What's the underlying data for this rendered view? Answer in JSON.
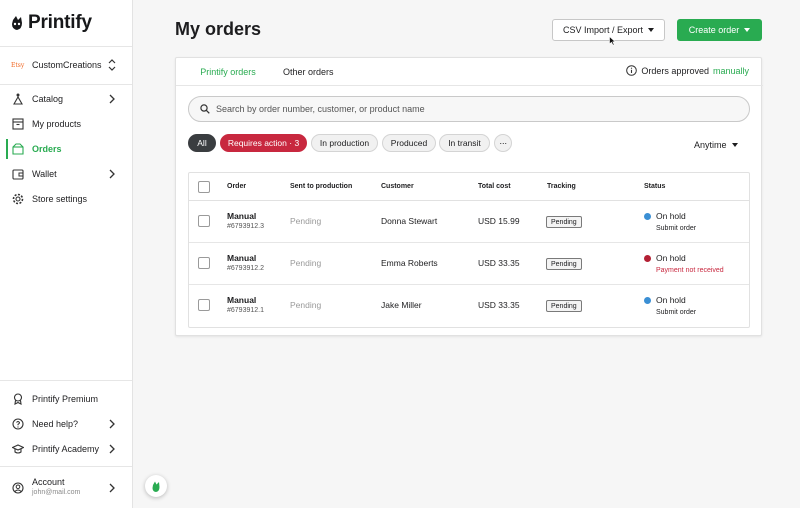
{
  "brand": {
    "name": "Printify",
    "accent": "#29ab51",
    "danger": "#c8283f"
  },
  "store": {
    "badge": "Etsy",
    "name": "CustomCreations"
  },
  "nav": [
    {
      "label": "Catalog",
      "icon": "catalog-icon"
    },
    {
      "label": "My products",
      "icon": "box-icon"
    },
    {
      "label": "Orders",
      "icon": "orders-icon"
    },
    {
      "label": "Wallet",
      "icon": "wallet-icon"
    },
    {
      "label": "Store settings",
      "icon": "gear-icon"
    }
  ],
  "bottom_nav": [
    {
      "label": "Printify Premium",
      "icon": "premium-icon"
    },
    {
      "label": "Need help?",
      "icon": "question-icon"
    },
    {
      "label": "Printify Academy",
      "icon": "academy-icon"
    }
  ],
  "account": {
    "label": "Account",
    "email": "john@mail.com"
  },
  "page": {
    "title": "My orders"
  },
  "header_buttons": {
    "csv": "CSV Import / Export",
    "create": "Create order"
  },
  "tabs": [
    "Printify orders",
    "Other orders"
  ],
  "approval": {
    "text": "Orders approved",
    "link": "manually"
  },
  "search": {
    "placeholder": "Search by order number, customer, or product name",
    "value": ""
  },
  "filters": [
    "All",
    "Requires action · 3",
    "In production",
    "Produced",
    "In transit",
    "···"
  ],
  "date_filter": "Anytime",
  "table": {
    "headers": [
      "Order",
      "Sent to production",
      "Customer",
      "Total cost",
      "Tracking",
      "Status"
    ],
    "rows": [
      {
        "order": "Manual",
        "order_id": "#6793912.3",
        "sent": "Pending",
        "customer": "Donna Stewart",
        "total": "USD 15.99",
        "tracking": "Pending",
        "status": "On hold",
        "status_sub": "Submit order",
        "dot_color": "#3b8fd4",
        "sub_color": "#1d1d1f"
      },
      {
        "order": "Manual",
        "order_id": "#6793912.2",
        "sent": "Pending",
        "customer": "Emma Roberts",
        "total": "USD 33.35",
        "tracking": "Pending",
        "status": "On hold",
        "status_sub": "Payment not received",
        "dot_color": "#b32034",
        "sub_color": "#c8283f"
      },
      {
        "order": "Manual",
        "order_id": "#6793912.1",
        "sent": "Pending",
        "customer": "Jake Miller",
        "total": "USD 33.35",
        "tracking": "Pending",
        "status": "On hold",
        "status_sub": "Submit order",
        "dot_color": "#3b8fd4",
        "sub_color": "#1d1d1f"
      }
    ]
  }
}
